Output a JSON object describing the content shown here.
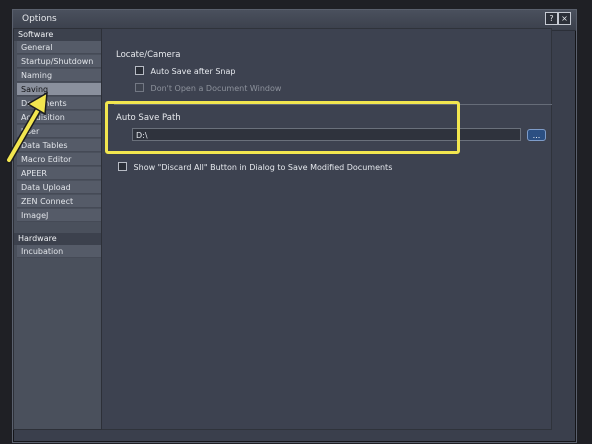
{
  "window": {
    "title": "Options",
    "help_label": "?",
    "close_label": "×"
  },
  "sidebar": {
    "categories": [
      {
        "label": "Software",
        "items": [
          {
            "label": "General"
          },
          {
            "label": "Startup/Shutdown"
          },
          {
            "label": "Naming"
          },
          {
            "label": "Saving",
            "selected": true
          },
          {
            "label": "Documents"
          },
          {
            "label": "Acquisition"
          },
          {
            "label": "User"
          },
          {
            "label": "Data Tables"
          },
          {
            "label": "Macro Editor"
          },
          {
            "label": "APEER"
          },
          {
            "label": "Data Upload"
          },
          {
            "label": "ZEN Connect"
          },
          {
            "label": "ImageJ"
          }
        ]
      },
      {
        "label": "Hardware",
        "items": [
          {
            "label": "Incubation"
          }
        ]
      }
    ]
  },
  "main": {
    "locate_camera": {
      "title": "Locate/Camera",
      "auto_save_after_snap": "Auto Save after Snap",
      "dont_open_window": "Don't Open a Document Window"
    },
    "auto_save_path": {
      "title": "Auto Save Path",
      "value": "D:\\",
      "browse_label": "..."
    },
    "discard_all": {
      "label": "Show \"Discard All\" Button in Dialog to Save Modified Documents"
    }
  },
  "annotation": {
    "highlight_color": "#f2e64f"
  }
}
